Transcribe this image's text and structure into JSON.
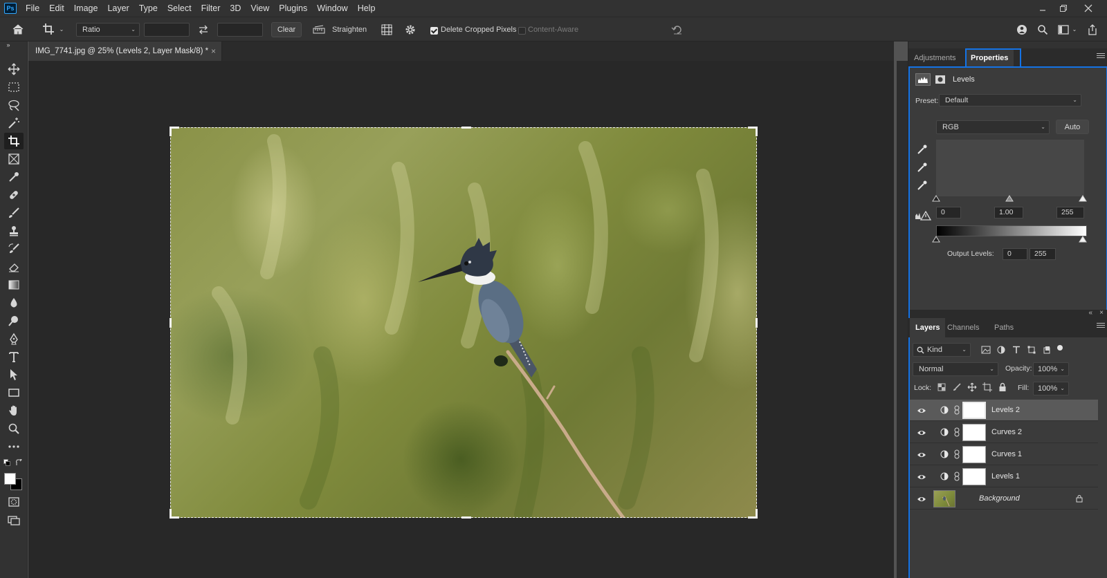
{
  "app": {
    "logo": "Ps"
  },
  "menu": [
    "File",
    "Edit",
    "Image",
    "Layer",
    "Type",
    "Select",
    "Filter",
    "3D",
    "View",
    "Plugins",
    "Window",
    "Help"
  ],
  "options": {
    "ratio": "Ratio",
    "clear": "Clear",
    "straighten": "Straighten",
    "delete_cropped": "Delete Cropped Pixels",
    "content_aware": "Content-Aware"
  },
  "document": {
    "tab_title": "IMG_7741.jpg @ 25% (Levels 2, Layer Mask/8) *",
    "close": "×"
  },
  "properties_panel": {
    "tabs": [
      "Adjustments",
      "Properties"
    ],
    "active_tab": "Properties",
    "adjustment_name": "Levels",
    "preset_label": "Preset:",
    "preset_value": "Default",
    "channel": "RGB",
    "auto": "Auto",
    "input_black": "0",
    "input_gamma": "1.00",
    "input_white": "255",
    "output_label": "Output Levels:",
    "output_black": "0",
    "output_white": "255"
  },
  "layers_panel": {
    "tabs": [
      "Layers",
      "Channels",
      "Paths"
    ],
    "active_tab": "Layers",
    "kind": "Kind",
    "blend_mode": "Normal",
    "opacity_label": "Opacity:",
    "opacity": "100%",
    "lock_label": "Lock:",
    "fill_label": "Fill:",
    "fill": "100%",
    "layers": [
      {
        "name": "Levels 2",
        "selected": true
      },
      {
        "name": "Curves 2",
        "selected": false
      },
      {
        "name": "Curves 1",
        "selected": false
      },
      {
        "name": "Levels 1",
        "selected": false
      },
      {
        "name": "Background",
        "selected": false
      }
    ]
  },
  "colors": {
    "accent": "#1473e6",
    "foreground": "#ffffff",
    "background": "#000000"
  }
}
